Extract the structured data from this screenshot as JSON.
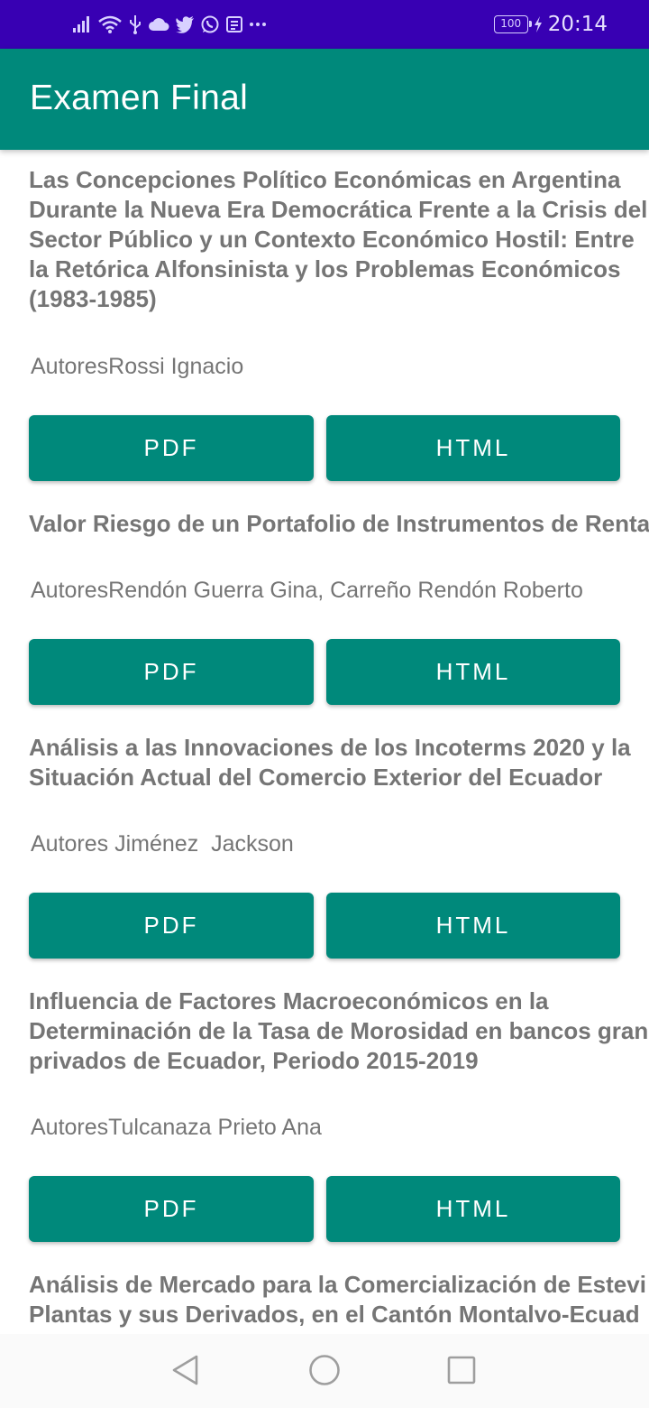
{
  "status_bar": {
    "icons": [
      "signal-icon",
      "wifi-icon",
      "usb-icon",
      "cloud-icon",
      "twitter-icon",
      "whatsapp-icon",
      "notification-icon",
      "more-icon"
    ],
    "battery": "100",
    "time": "20:14"
  },
  "app_bar": {
    "title": "Examen Final"
  },
  "articles": [
    {
      "title_lines": [
        "Las Concepciones Político Económicas en Argentina",
        "Durante la Nueva Era Democrática Frente a la Crisis del",
        "Sector Público y un Contexto Económico Hostil: Entre",
        "la Retórica Alfonsinista y los Problemas Económicos",
        "(1983-1985)"
      ],
      "authors": "AutoresRossi Ignacio",
      "pdf_label": "PDF",
      "html_label": "HTML"
    },
    {
      "title_lines": [
        "Valor Riesgo de un Portafolio de Instrumentos de Renta"
      ],
      "authors": "AutoresRendón Guerra Gina, Carreño Rendón Roberto",
      "pdf_label": "PDF",
      "html_label": "HTML"
    },
    {
      "title_lines": [
        "Análisis a las Innovaciones de los Incoterms 2020 y la",
        "Situación Actual del Comercio Exterior del Ecuador"
      ],
      "authors": "Autores Jiménez  Jackson",
      "pdf_label": "PDF",
      "html_label": "HTML"
    },
    {
      "title_lines": [
        "Influencia de Factores Macroeconómicos en la",
        "Determinación de la Tasa de Morosidad en bancos gran",
        "privados de Ecuador, Periodo 2015-2019"
      ],
      "authors": "AutoresTulcanaza Prieto Ana",
      "pdf_label": "PDF",
      "html_label": "HTML"
    },
    {
      "title_lines": [
        "Análisis de Mercado para la Comercialización de Estevi",
        "Plantas y sus Derivados, en el Cantón Montalvo-Ecuad"
      ]
    }
  ],
  "nav_bar": {
    "buttons": [
      "back-icon",
      "home-icon",
      "recents-icon"
    ]
  },
  "colors": {
    "status_bar": "#3800b3",
    "primary": "#00897b",
    "text_gray": "#757575"
  }
}
